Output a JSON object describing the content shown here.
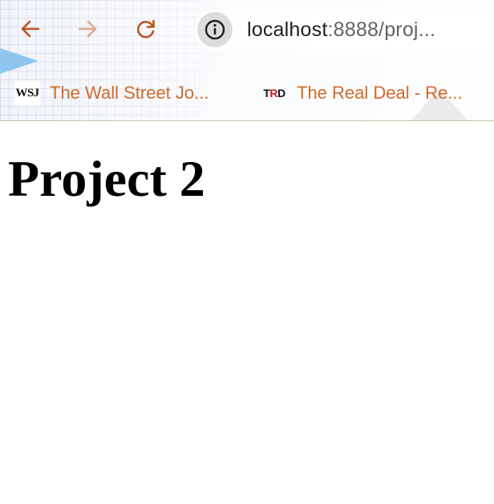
{
  "browser": {
    "url_host": "localhost",
    "url_rest": ":8888/proj...",
    "icons": {
      "back": "arrow-left-icon",
      "forward": "arrow-right-icon",
      "reload": "reload-icon",
      "site_info": "info-icon"
    },
    "colors": {
      "nav_active": "#b8561f",
      "nav_disabled": "#d9a98a",
      "bookmark_text": "#d06a2b"
    }
  },
  "bookmarks": [
    {
      "favicon_text": "WSJ",
      "label": "The Wall Street Jo..."
    },
    {
      "favicon_text_a": "T",
      "favicon_text_b": "R",
      "favicon_text_c": "D",
      "label": "The Real Deal - Re..."
    }
  ],
  "page": {
    "title": "Project 2"
  }
}
